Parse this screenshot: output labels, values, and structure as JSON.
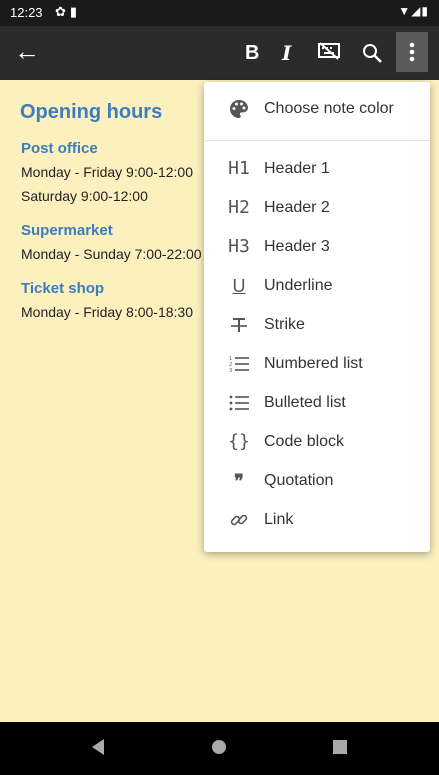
{
  "status_bar": {
    "time": "12:23"
  },
  "note": {
    "title": "Opening hours",
    "sections": [
      {
        "title": "Post office",
        "lines": [
          "Monday - Friday 9:00-12:00",
          "Saturday 9:00-12:00"
        ]
      },
      {
        "title": "Supermarket",
        "lines": [
          "Monday - Sunday 7:00-22:00"
        ]
      },
      {
        "title": "Ticket shop",
        "lines": [
          "Monday - Friday 8:00-18:30"
        ]
      }
    ]
  },
  "menu": {
    "items": [
      {
        "label": "Choose note color",
        "icon": "palette-icon"
      },
      {
        "label": "Header 1",
        "icon": "h1-icon",
        "glyph": "H1"
      },
      {
        "label": "Header 2",
        "icon": "h2-icon",
        "glyph": "H2"
      },
      {
        "label": "Header 3",
        "icon": "h3-icon",
        "glyph": "H3"
      },
      {
        "label": "Underline",
        "icon": "underline-icon",
        "glyph": "U"
      },
      {
        "label": "Strike",
        "icon": "strike-icon"
      },
      {
        "label": "Numbered list",
        "icon": "numbered-list-icon"
      },
      {
        "label": "Bulleted list",
        "icon": "bulleted-list-icon"
      },
      {
        "label": "Code block",
        "icon": "code-block-icon",
        "glyph": "{}"
      },
      {
        "label": "Quotation",
        "icon": "quotation-icon",
        "glyph": "❞"
      },
      {
        "label": "Link",
        "icon": "link-icon"
      }
    ]
  },
  "toolbar": {
    "bold_glyph": "B",
    "italic_glyph": "I"
  },
  "colors": {
    "note_background": "#FBF0BE",
    "accent": "#3C7DBE",
    "toolbar": "#2b2b2b"
  }
}
